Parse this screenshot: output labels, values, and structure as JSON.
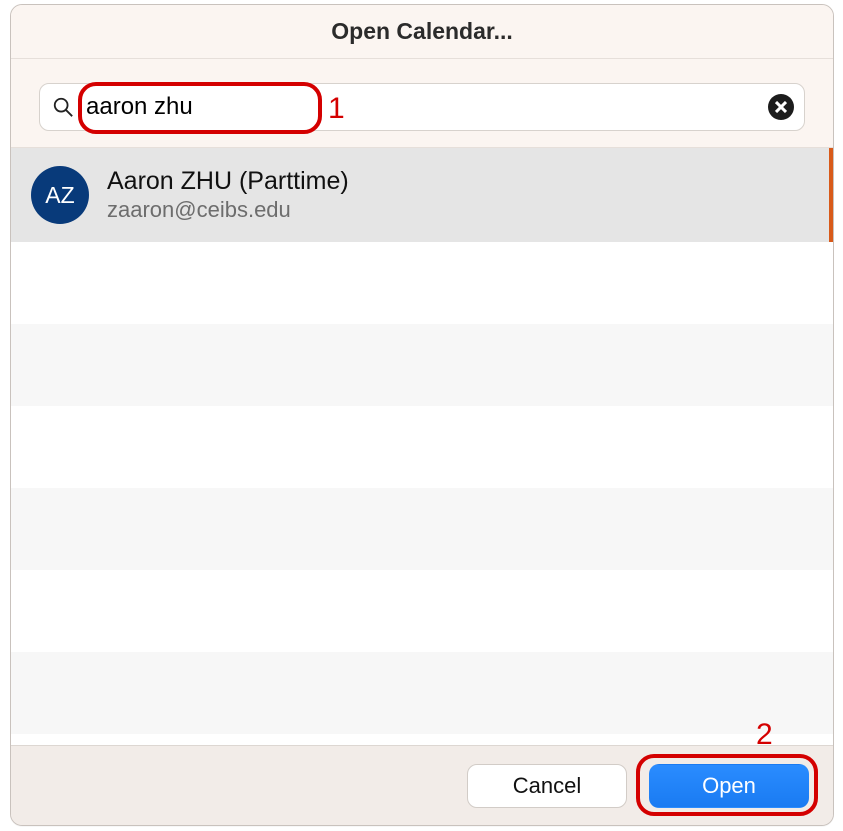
{
  "dialog": {
    "title": "Open Calendar..."
  },
  "search": {
    "value": "aaron zhu",
    "placeholder": ""
  },
  "result": {
    "initials": "AZ",
    "name": "Aaron ZHU (Parttime)",
    "email": "zaaron@ceibs.edu"
  },
  "footer": {
    "cancel_label": "Cancel",
    "open_label": "Open"
  },
  "annotations": {
    "box1_label": "1",
    "box2_label": "2"
  },
  "colors": {
    "primary_button": "#1e83ff",
    "avatar_bg": "#083a7a",
    "annotation": "#d40000"
  }
}
